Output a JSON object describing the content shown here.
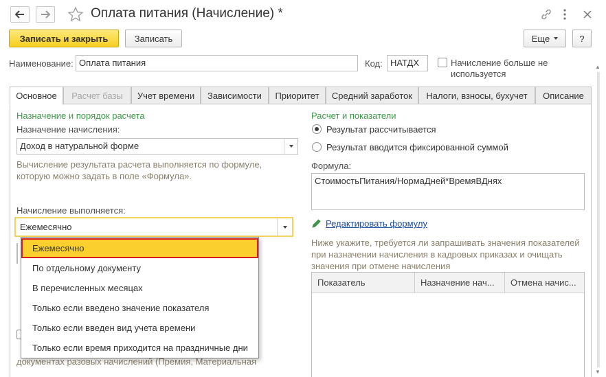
{
  "window": {
    "title": "Оплата питания (Начисление) *",
    "icons": [
      "back-arrow-icon",
      "forward-arrow-icon",
      "star-icon",
      "link-icon",
      "more-vertical-icon",
      "close-icon"
    ]
  },
  "toolbar": {
    "save_close": "Записать и закрыть",
    "save": "Записать",
    "more": "Еще",
    "help": "?"
  },
  "form": {
    "name_label": "Наименование:",
    "name_value": "Оплата питания",
    "code_label": "Код:",
    "code_value": "НАТДХ",
    "not_used_label_1": "Начисление больше не",
    "not_used_label_2": "используется"
  },
  "tabs": [
    {
      "label": "Основное",
      "state": "active"
    },
    {
      "label": "Расчет базы",
      "state": "disabled"
    },
    {
      "label": "Учет времени",
      "state": "normal"
    },
    {
      "label": "Зависимости",
      "state": "normal"
    },
    {
      "label": "Приоритет",
      "state": "normal"
    },
    {
      "label": "Средний заработок",
      "state": "normal"
    },
    {
      "label": "Налоги, взносы, бухучет",
      "state": "normal"
    },
    {
      "label": "Описание",
      "state": "normal"
    }
  ],
  "left": {
    "section_title": "Назначение и порядок расчета",
    "purpose_label": "Назначение начисления:",
    "purpose_value": "Доход в натуральной форме",
    "hint_1": "Вычисление результата расчета выполняется по формуле,",
    "hint_2": "которую можно задать в поле «Формула».",
    "exec_label": "Начисление выполняется:",
    "exec_value": "Ежемесячно",
    "bottom_text": "документах разовых начислений (Премия, Материальная"
  },
  "dropdown": {
    "items": [
      "Ежемесячно",
      "По отдельному документу",
      "В перечисленных месяцах",
      "Только если введено значение показателя",
      "Только если введен вид учета времени",
      "Только если время приходится на праздничные дни"
    ],
    "selected_index": 0
  },
  "right": {
    "section_title": "Расчет и показатели",
    "radio_calculated": "Результат рассчитывается",
    "radio_fixed": "Результат вводится фиксированной суммой",
    "radio_selected": "calculated",
    "formula_label": "Формула:",
    "formula_value": "СтоимостьПитания/НормаДней*ВремяВДнях",
    "edit_formula_link": "Редактировать формулу",
    "indicators_hint_1": "Ниже укажите, требуется ли запрашивать значения показателей",
    "indicators_hint_2": "при назначении начисления в кадровых приказах и очищать",
    "indicators_hint_3": "значения при отмене начисления",
    "grid_columns": [
      "Показатель",
      "Назначение нач...",
      "Отмена начис..."
    ]
  },
  "colors": {
    "accent_yellow": "#f5cf22",
    "section_green": "#3d9b48",
    "selection_border": "#d61f1f",
    "link_blue": "#1c4ea0"
  }
}
